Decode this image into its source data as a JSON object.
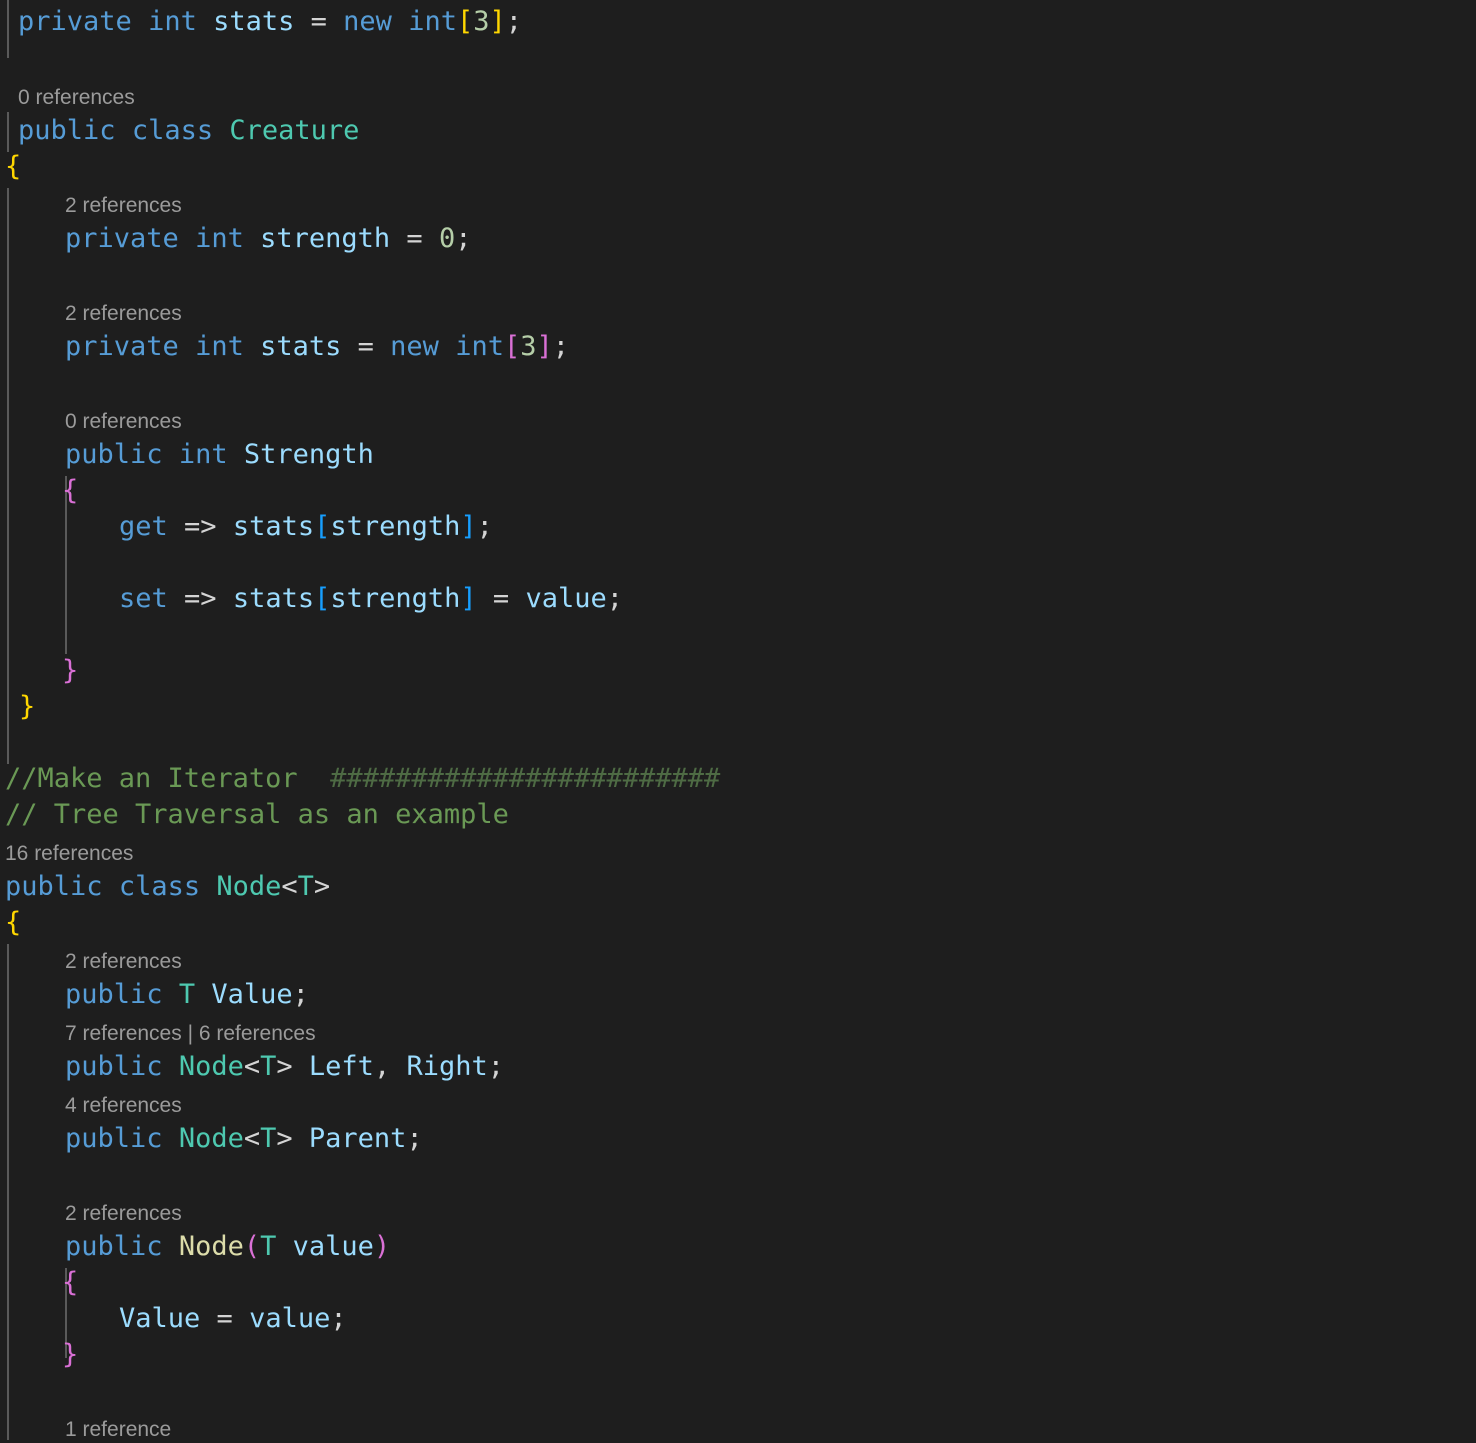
{
  "editor": {
    "language": "csharp",
    "theme": "dark-plus",
    "background": "#1e1e1e",
    "font_size_px": 27,
    "line_height_px": 36,
    "colors": {
      "keyword": "#569cd6",
      "type": "#4ec9b0",
      "identifier": "#9cdcfe",
      "operator": "#d4d4d4",
      "number": "#b5cea8",
      "method": "#dcdcaa",
      "comment": "#6a9955",
      "comment_dim": "#4e6b44",
      "codelens": "#9b9b9b",
      "indent_guide": "#5a5a5a",
      "bracket_depth0": "#ffd700",
      "bracket_depth1": "#da70d6",
      "bracket_depth2": "#179fff"
    }
  },
  "code": {
    "l01": {
      "kw1": "private",
      "kw2": "int",
      "name": "stats",
      "eq": " = ",
      "kw3": "new",
      "kw4": "int",
      "br_open": "[",
      "num": "3",
      "br_close": "]",
      "semi": ";"
    },
    "lens_creature": "0 references",
    "l_creature": {
      "kw1": "public",
      "kw2": "class",
      "type": "Creature"
    },
    "l_creature_open": "{",
    "lens_strength_field": "2 references",
    "l_strength_field": {
      "kw1": "private",
      "kw2": "int",
      "name": "strength",
      "eq": " = ",
      "num": "0",
      "semi": ";"
    },
    "lens_stats_field": "2 references",
    "l_stats_field": {
      "kw1": "private",
      "kw2": "int",
      "name": "stats",
      "eq": " = ",
      "kw3": "new",
      "kw4": "int",
      "br_open": "[",
      "num": "3",
      "br_close": "]",
      "semi": ";"
    },
    "lens_strength_prop": "0 references",
    "l_strength_prop": {
      "kw1": "public",
      "kw2": "int",
      "name": "Strength"
    },
    "l_prop_open": "{",
    "l_get": {
      "kw": "get",
      "arrow": " => ",
      "name": "stats",
      "br_open": "[",
      "index": "strength",
      "br_close": "]",
      "semi": ";"
    },
    "l_set": {
      "kw": "set",
      "arrow": " => ",
      "name": "stats",
      "br_open": "[",
      "index": "strength",
      "br_close": "]",
      "eq": " = ",
      "value": "value",
      "semi": ";"
    },
    "l_prop_close": "}",
    "l_creature_close": "}",
    "cmt_iterator_text": "//Make an Iterator  ",
    "cmt_iterator_hashes": "########################",
    "cmt_tree": "// Tree Traversal as an example",
    "lens_node": "16 references",
    "l_node": {
      "kw1": "public",
      "kw2": "class",
      "type": "Node",
      "lt": "<",
      "generic": "T",
      "gt": ">"
    },
    "l_node_open": "{",
    "lens_value": "2 references",
    "l_value": {
      "kw": "public",
      "type": "T",
      "name": "Value",
      "semi": ";"
    },
    "lens_left_right": "7 references | 6 references",
    "l_left_right": {
      "kw": "public",
      "type": "Node",
      "lt": "<",
      "generic": "T",
      "gt": ">",
      "name1": "Left",
      "comma": ", ",
      "name2": "Right",
      "semi": ";"
    },
    "lens_parent": "4 references",
    "l_parent": {
      "kw": "public",
      "type": "Node",
      "lt": "<",
      "generic": "T",
      "gt": ">",
      "name": "Parent",
      "semi": ";"
    },
    "lens_ctor": "2 references",
    "l_ctor": {
      "kw": "public",
      "meth": "Node",
      "paren_open": "(",
      "type": "T",
      "param": " value",
      "paren_close": ")"
    },
    "l_ctor_open": "{",
    "l_ctor_body": {
      "name": "Value",
      "eq": " = ",
      "value": "value",
      "semi": ";"
    },
    "l_ctor_close": "}",
    "lens_last": "1 reference"
  }
}
